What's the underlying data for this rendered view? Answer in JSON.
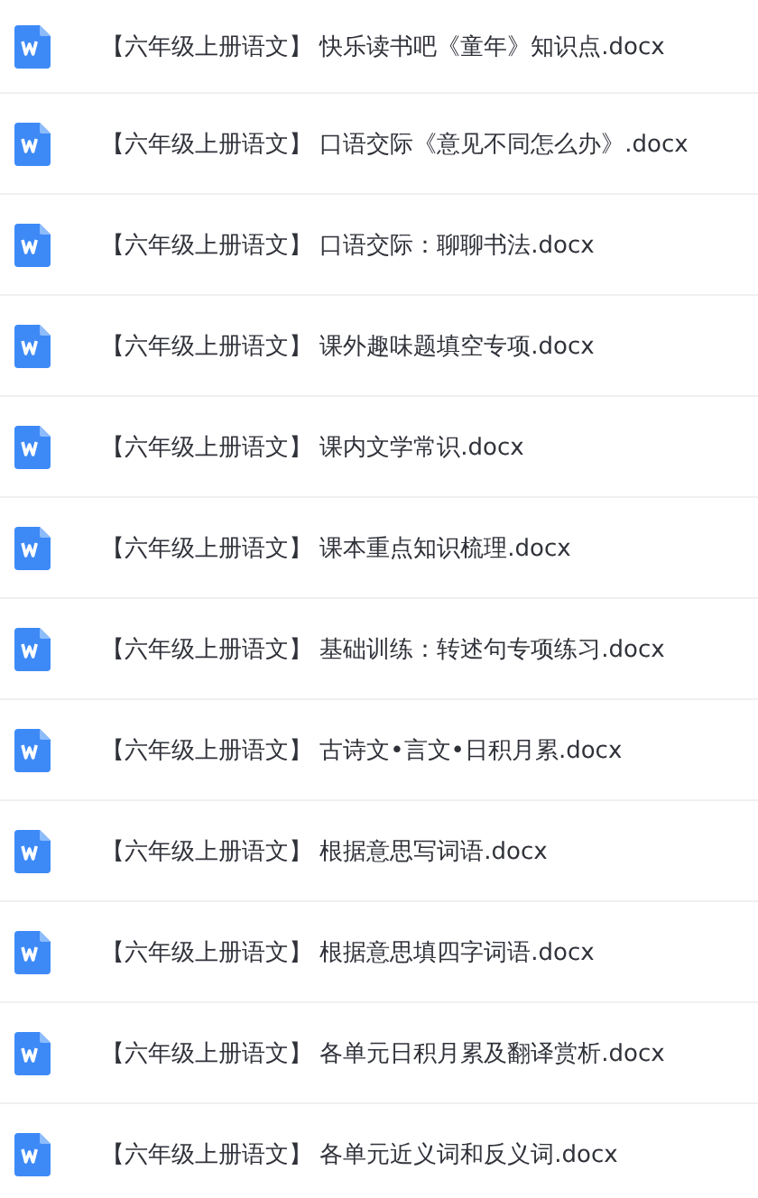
{
  "files": [
    {
      "name": "【六年级上册语文】 快乐读书吧《童年》知识点.docx"
    },
    {
      "name": "【六年级上册语文】 口语交际《意见不同怎么办》.docx"
    },
    {
      "name": "【六年级上册语文】 口语交际：聊聊书法.docx"
    },
    {
      "name": "【六年级上册语文】 课外趣味题填空专项.docx"
    },
    {
      "name": "【六年级上册语文】 课内文学常识.docx"
    },
    {
      "name": "【六年级上册语文】 课本重点知识梳理.docx"
    },
    {
      "name": "【六年级上册语文】 基础训练：转述句专项练习.docx"
    },
    {
      "name": "【六年级上册语文】 古诗文•言文•日积月累.docx"
    },
    {
      "name": "【六年级上册语文】 根据意思写词语.docx"
    },
    {
      "name": "【六年级上册语文】 根据意思填四字词语.docx"
    },
    {
      "name": "【六年级上册语文】 各单元日积月累及翻译赏析.docx"
    },
    {
      "name": "【六年级上册语文】 各单元近义词和反义词.docx"
    }
  ]
}
